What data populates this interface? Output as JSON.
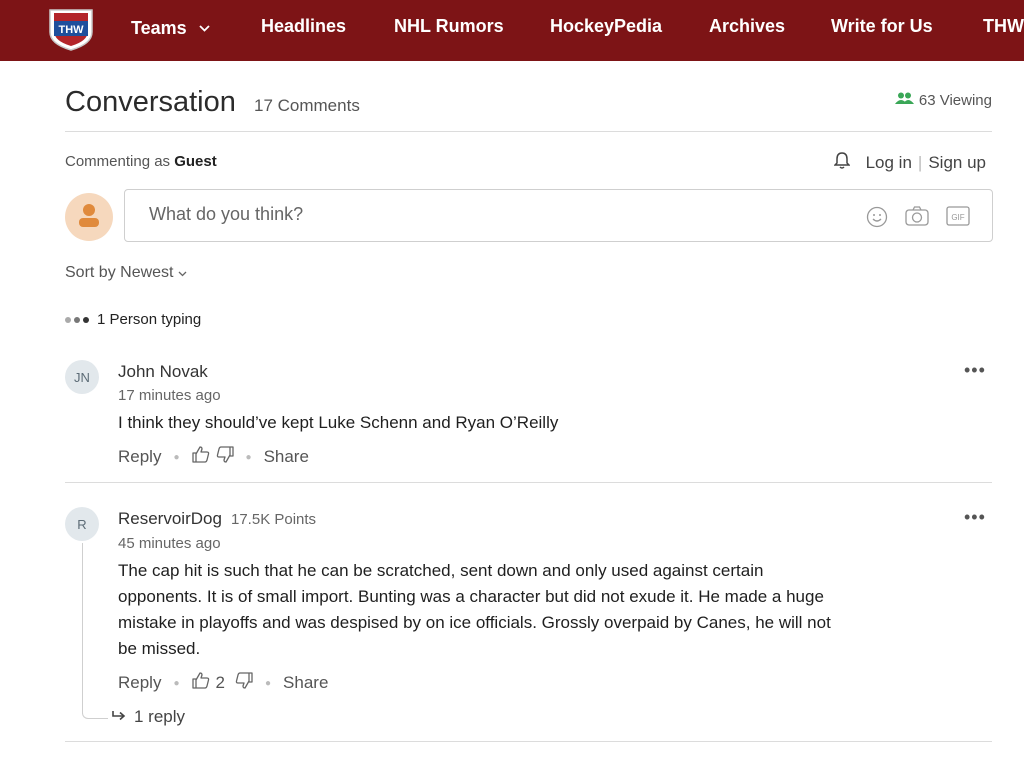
{
  "logo": {
    "text": "THW"
  },
  "nav": {
    "items": [
      {
        "label": "Teams"
      },
      {
        "label": "Headlines"
      },
      {
        "label": "NHL Rumors"
      },
      {
        "label": "HockeyPedia"
      },
      {
        "label": "Archives"
      },
      {
        "label": "Write for Us"
      },
      {
        "label": "THW"
      }
    ]
  },
  "conversation": {
    "title": "Conversation",
    "count": "17 Comments",
    "viewing": "63 Viewing"
  },
  "session": {
    "commenting_prefix": "Commenting as",
    "user": "Guest",
    "login": "Log in",
    "signup": "Sign up"
  },
  "composer": {
    "placeholder": "What do you think?",
    "gif_label": "GIF"
  },
  "sort": {
    "label": "Sort by Newest"
  },
  "typing": {
    "label": "1 Person typing"
  },
  "comments": [
    {
      "initials": "JN",
      "author": "John Novak",
      "points": "",
      "time": "17 minutes ago",
      "text": "I think they should’ve kept Luke Schenn and Ryan O’Reilly",
      "reply_label": "Reply",
      "likes": "",
      "share_label": "Share"
    },
    {
      "initials": "R",
      "author": "ReservoirDog",
      "points": "17.5K Points",
      "time": "45 minutes ago",
      "text_lines": [
        "The cap hit is such that he can be scratched, sent down and only used against certain",
        "opponents. It is of small import. Bunting was a character but did not exude it. He made a huge",
        "mistake in playoffs and was despised by on ice officials. Grossly overpaid by Canes, he will not",
        "be missed."
      ],
      "reply_label": "Reply",
      "likes": "2",
      "share_label": "Share",
      "replies": "1 reply"
    }
  ],
  "colors": {
    "nav_bg": "#7d1416",
    "viewing_icon": "#3aa757",
    "guest_avatar": "#f6d8bd",
    "guest_icon": "#e08a3c"
  }
}
